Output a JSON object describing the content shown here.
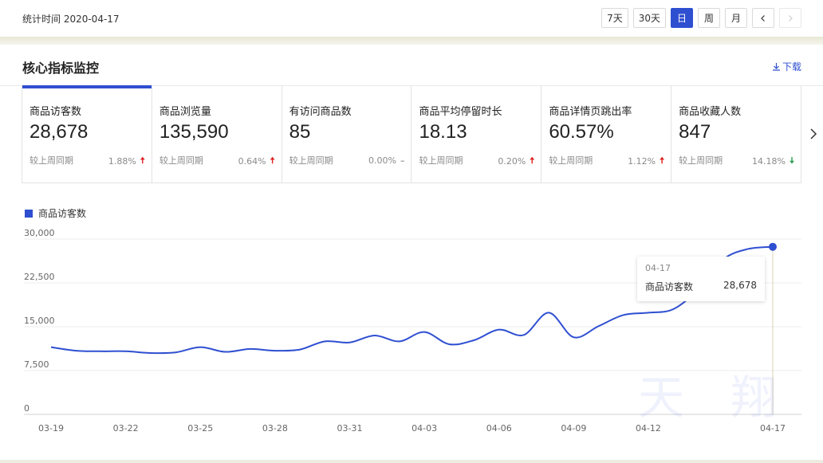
{
  "header": {
    "stat_time": "统计时间 2020-04-17",
    "ranges": [
      "7天",
      "30天",
      "日",
      "周",
      "月"
    ],
    "active_range": "日"
  },
  "section": {
    "title": "核心指标监控",
    "download": "下载"
  },
  "metrics": [
    {
      "label": "商品访客数",
      "value": "28,678",
      "compare": "较上周同期",
      "change": "1.88%",
      "trend": "up"
    },
    {
      "label": "商品浏览量",
      "value": "135,590",
      "compare": "较上周同期",
      "change": "0.64%",
      "trend": "up"
    },
    {
      "label": "有访问商品数",
      "value": "85",
      "compare": "较上周同期",
      "change": "0.00%",
      "trend": "flat"
    },
    {
      "label": "商品平均停留时长",
      "value": "18.13",
      "compare": "较上周同期",
      "change": "0.20%",
      "trend": "up"
    },
    {
      "label": "商品详情页跳出率",
      "value": "60.57%",
      "compare": "较上周同期",
      "change": "1.12%",
      "trend": "up"
    },
    {
      "label": "商品收藏人数",
      "value": "847",
      "compare": "较上周同期",
      "change": "14.18%",
      "trend": "down"
    }
  ],
  "chart_data": {
    "type": "line",
    "series": [
      {
        "name": "商品访客数",
        "color": "#2f4fd1",
        "values": [
          11500,
          10900,
          10800,
          10800,
          10500,
          10600,
          11500,
          10700,
          11200,
          10900,
          11100,
          12500,
          12300,
          13500,
          12500,
          14100,
          12000,
          12700,
          14500,
          13600,
          17400,
          13200,
          15100,
          17000,
          17400,
          18000,
          21400,
          26500,
          28300,
          28678
        ]
      }
    ],
    "x": [
      "03-19",
      "03-20",
      "03-21",
      "03-22",
      "03-23",
      "03-24",
      "03-25",
      "03-26",
      "03-27",
      "03-28",
      "03-29",
      "03-30",
      "03-31",
      "04-01",
      "04-02",
      "04-03",
      "04-04",
      "04-05",
      "04-06",
      "04-07",
      "04-08",
      "04-09",
      "04-10",
      "04-11",
      "04-12",
      "04-13",
      "04-14",
      "04-15",
      "04-16",
      "04-17"
    ],
    "x_tick_labels": [
      "03-19",
      "03-22",
      "03-25",
      "03-28",
      "03-31",
      "04-03",
      "04-06",
      "04-09",
      "04-12",
      "04-17"
    ],
    "y_tick_labels": [
      "30,000",
      "22,500",
      "15,000",
      "7,500",
      "0"
    ],
    "ylim": [
      0,
      30000
    ],
    "grid": true,
    "legend": "top-left",
    "tooltip": {
      "date": "04-17",
      "label": "商品访客数",
      "value": "28,678"
    }
  },
  "watermark": "天猫"
}
